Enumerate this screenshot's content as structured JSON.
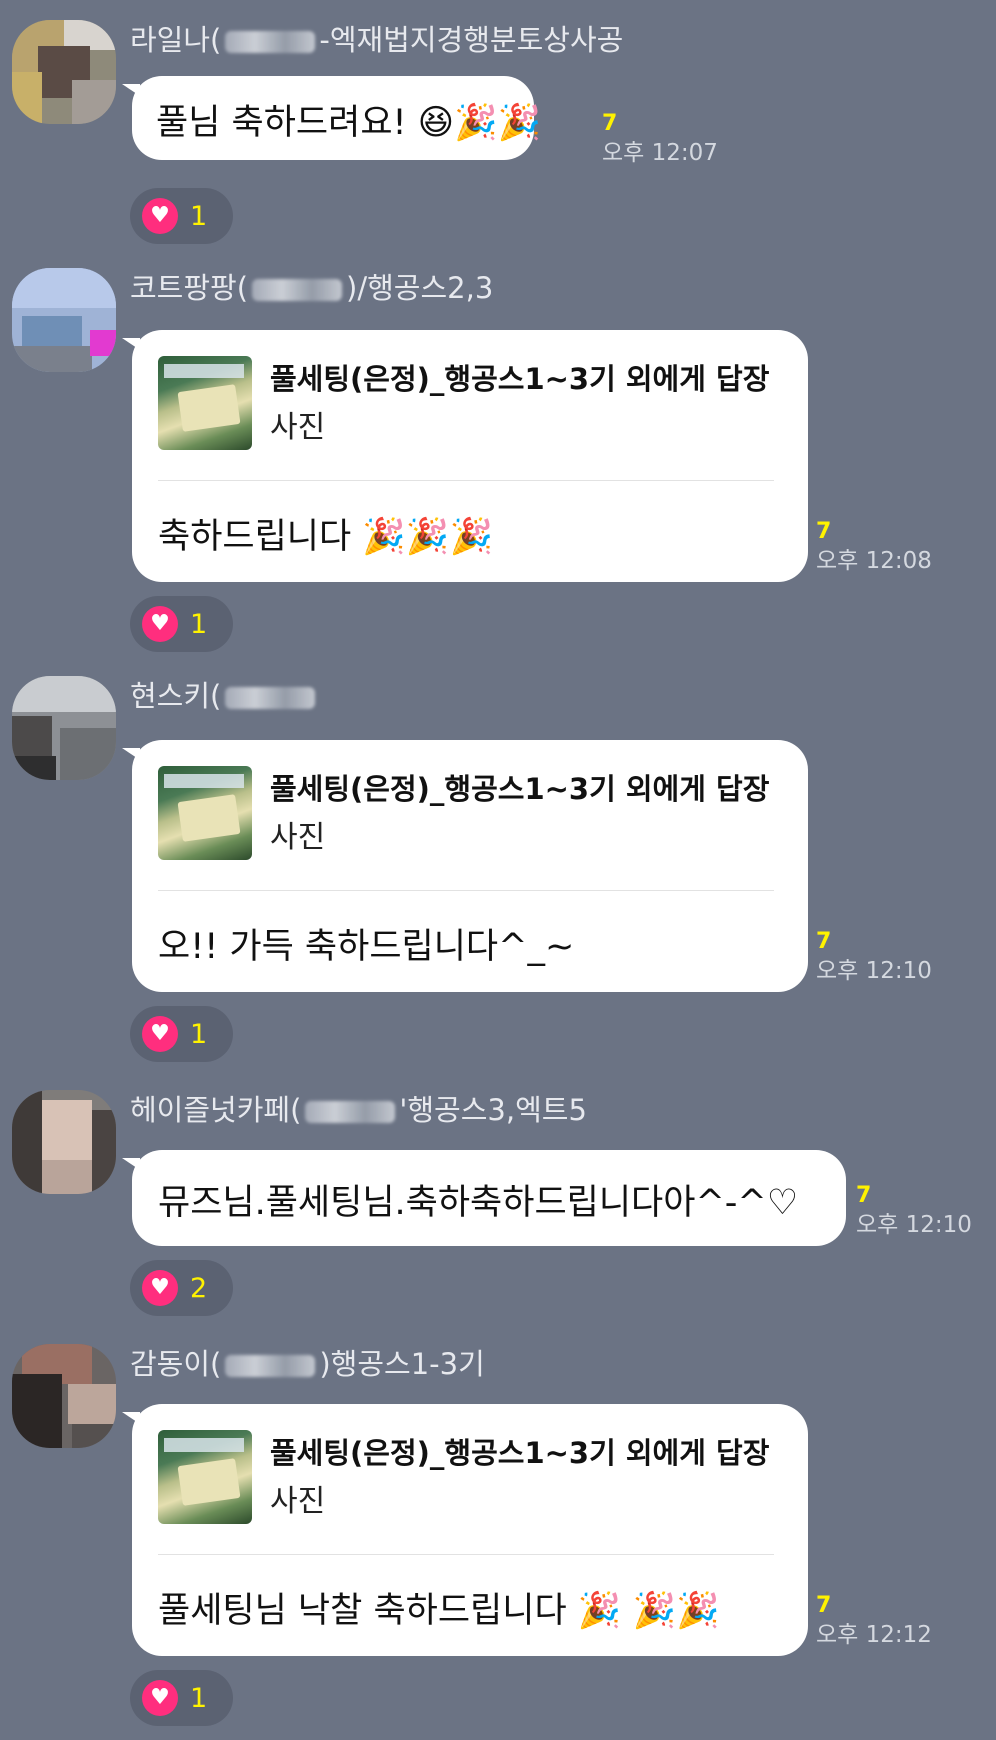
{
  "messages": [
    {
      "sender": "라일나(",
      "sender_tail": "-엑재법지경행분토상사공",
      "reply": null,
      "text": "풀님 축하드려요! 😆🎉🎉",
      "unread": "7",
      "time": "오후 12:07",
      "reaction_count": "1"
    },
    {
      "sender": "코트팡팡(",
      "sender_tail": ")/행공스2,3",
      "reply": {
        "title": "풀세팅(은정)_행공스1~3기 외에게 답장",
        "sub": "사진"
      },
      "text": "축하드립니다 🎉🎉🎉",
      "unread": "7",
      "time": "오후 12:08",
      "reaction_count": "1"
    },
    {
      "sender": "현스키(",
      "sender_tail": "",
      "reply": {
        "title": "풀세팅(은정)_행공스1~3기 외에게 답장",
        "sub": "사진"
      },
      "text": "오!! 가득 축하드립니다^_~",
      "unread": "7",
      "time": "오후 12:10",
      "reaction_count": "1"
    },
    {
      "sender": "헤이즐넛카페(",
      "sender_tail": "'행공스3,엑트5",
      "reply": null,
      "text": "뮤즈님.풀세팅님.축하축하드립니다아^-^♡",
      "unread": "7",
      "time": "오후 12:10",
      "reaction_count": "2"
    },
    {
      "sender": "감동이(",
      "sender_tail": ")행공스1-3기",
      "reply": {
        "title": "풀세팅(은정)_행공스1~3기 외에게 답장",
        "sub": "사진"
      },
      "text": "풀세팅님 낙찰 축하드립니다 🎉 🎉🎉",
      "unread": "7",
      "time": "오후 12:12",
      "reaction_count": "1"
    }
  ],
  "icons": {
    "reaction": "heart-icon"
  },
  "colors": {
    "background": "#6b7384",
    "unread": "#fff200",
    "heart": "#ff2e7e"
  }
}
